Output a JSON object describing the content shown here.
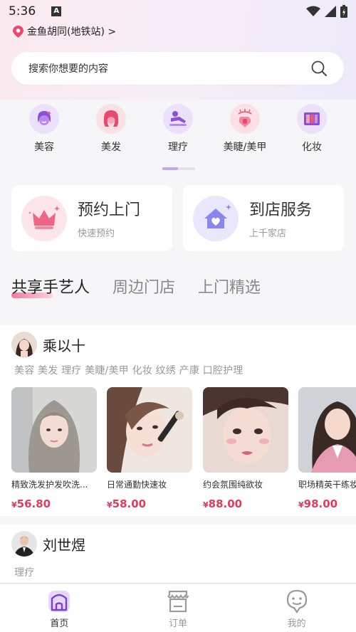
{
  "status_bar": {
    "time": "5:36"
  },
  "header": {
    "location": "金鱼胡同(地铁站) >"
  },
  "search": {
    "placeholder": "搜索你想要的内容"
  },
  "categories": [
    {
      "label": "美容",
      "icon": "face-icon"
    },
    {
      "label": "美发",
      "icon": "hair-icon"
    },
    {
      "label": "理疗",
      "icon": "massage-icon"
    },
    {
      "label": "美睫/美甲",
      "icon": "nail-icon"
    },
    {
      "label": "化妆",
      "icon": "makeup-palette-icon"
    }
  ],
  "service_cards": [
    {
      "title": "预约上门",
      "subtitle": "快速预约",
      "icon": "crown-icon"
    },
    {
      "title": "到店服务",
      "subtitle": "上千家店",
      "icon": "house-icon"
    }
  ],
  "tabs": [
    "共享手艺人",
    "周边门店",
    "上门精选"
  ],
  "artists": [
    {
      "name": "乘以十",
      "tags": "美容 美发 理疗 美睫/美甲 化妆 纹绣 产康 口腔护理",
      "services": [
        {
          "name": "精致洗发护发吹洗...",
          "price": "56.80"
        },
        {
          "name": "日常通勤快速妆",
          "price": "58.00"
        },
        {
          "name": "约会氛围纯欲妆",
          "price": "88.00"
        },
        {
          "name": "职场精英干练妆",
          "price": "98.00"
        }
      ]
    },
    {
      "name": "刘世煜",
      "tags": "理疗"
    }
  ],
  "currency": "¥",
  "bottom_nav": [
    {
      "label": "首页",
      "icon": "home-icon"
    },
    {
      "label": "订单",
      "icon": "order-icon"
    },
    {
      "label": "我的",
      "icon": "profile-icon"
    }
  ],
  "colors": {
    "accent": "#e33a5c",
    "brand_purple": "#7c4bd6"
  }
}
